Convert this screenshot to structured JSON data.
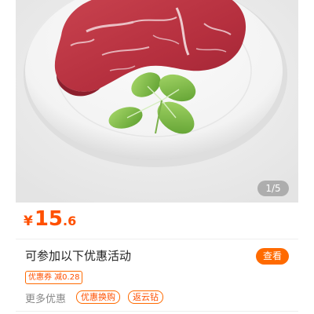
{
  "gallery": {
    "image": "raw-beef-steak-with-basil-leaves-on-white-plate",
    "counter": "1/5"
  },
  "price": {
    "currency": "¥",
    "integer": "15",
    "decimal": ".6"
  },
  "promotions": {
    "title": "可参加以下优惠活动",
    "view_button": "查看",
    "coupon": "优惠券 减0.28",
    "more_label": "更多优惠",
    "tags": [
      "优惠换购",
      "返云钻"
    ]
  },
  "colors": {
    "accent": "#ff6a00",
    "price": "#ff5000"
  }
}
